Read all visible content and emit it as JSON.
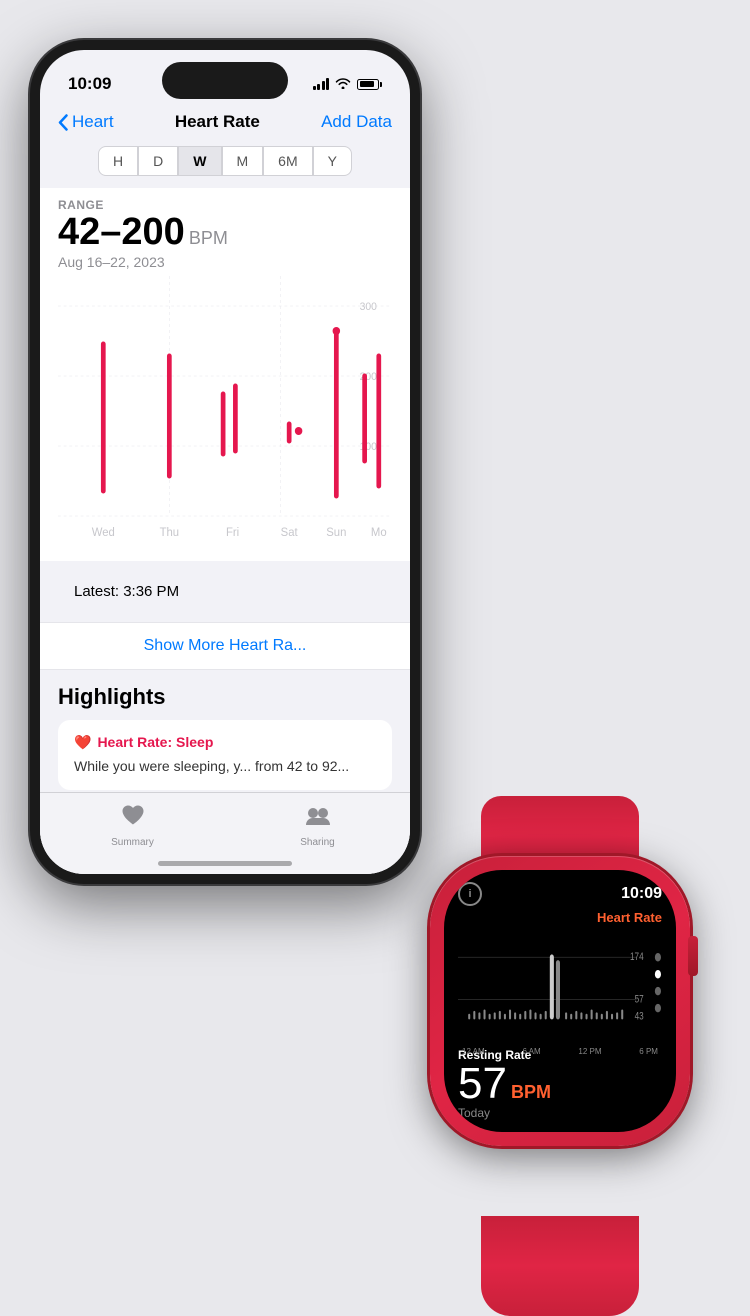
{
  "statusBar": {
    "time": "10:09",
    "signal": "signal",
    "wifi": "wifi",
    "battery": "battery"
  },
  "nav": {
    "backLabel": "Heart",
    "title": "Heart Rate",
    "actionLabel": "Add Data"
  },
  "timeTabs": [
    {
      "id": "H",
      "label": "H",
      "active": false
    },
    {
      "id": "D",
      "label": "D",
      "active": false
    },
    {
      "id": "W",
      "label": "W",
      "active": true
    },
    {
      "id": "M",
      "label": "M",
      "active": false
    },
    {
      "id": "6M",
      "label": "6M",
      "active": false
    },
    {
      "id": "Y",
      "label": "Y",
      "active": false
    }
  ],
  "chart": {
    "rangeLabel": "RANGE",
    "rangeValue": "42–200",
    "unit": "BPM",
    "dateRange": "Aug 16–22, 2023",
    "yLabels": [
      "300",
      "200",
      "100"
    ],
    "xLabels": [
      "Wed",
      "Thu",
      "Fri",
      "Sat",
      "Sun",
      "Mo"
    ]
  },
  "latest": {
    "label": "Latest: 3:36 PM"
  },
  "showMore": {
    "label": "Show More Heart Ra..."
  },
  "highlights": {
    "title": "Highlights",
    "card": {
      "tag": "Heart Rate: Sleep",
      "body": "While you were sleeping, y... from 42 to 92..."
    }
  },
  "tabBar": {
    "tabs": [
      {
        "label": "Summary",
        "active": true
      },
      {
        "label": "Sharing",
        "active": false
      }
    ]
  },
  "watch": {
    "time": "10:09",
    "title": "Heart Rate",
    "infoLabel": "i",
    "yLabels": [
      "174",
      "57",
      "43"
    ],
    "xLabels": [
      "12 AM",
      "6 AM",
      "12 PM",
      "6 PM"
    ],
    "restingLabel": "Resting Rate",
    "bpm": "57",
    "unit": "BPM",
    "todayLabel": "Today"
  }
}
